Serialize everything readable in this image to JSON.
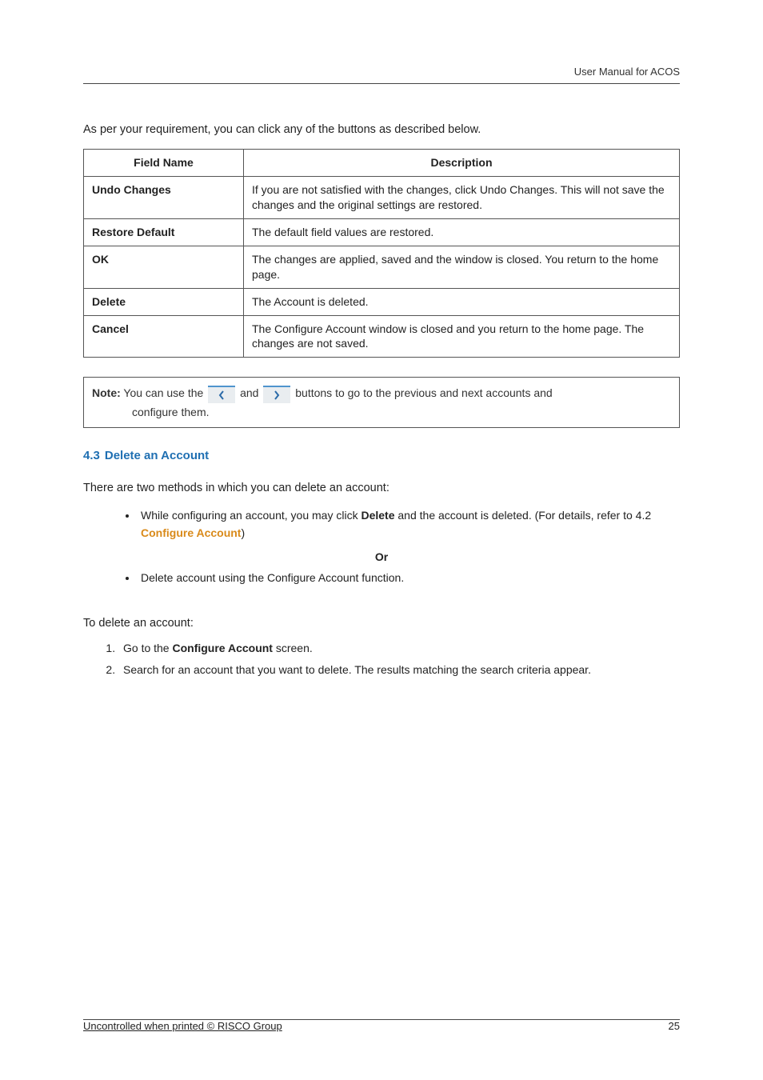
{
  "header": {
    "doc_title": "User Manual for ACOS"
  },
  "intro": "As per your requirement, you can click any of the buttons as described below.",
  "table": {
    "headers": {
      "field": "Field Name",
      "desc": "Description"
    },
    "rows": [
      {
        "field": "Undo Changes",
        "desc": "If you are not satisfied with the changes, click Undo Changes. This will not save the changes and the original settings are restored."
      },
      {
        "field": "Restore Default",
        "desc": "The default field values are restored."
      },
      {
        "field": "OK",
        "desc": "The changes are applied, saved and the window is closed. You return to the home page."
      },
      {
        "field": "Delete",
        "desc": "The Account is deleted."
      },
      {
        "field": "Cancel",
        "desc": "The Configure Account window is closed and you return to the home page. The changes are not saved."
      }
    ]
  },
  "note": {
    "label": "Note:",
    "part1": " You can use the ",
    "and": " and ",
    "part2": " buttons to go to the previous and next accounts and",
    "line2": "configure them."
  },
  "section": {
    "num": "4.3",
    "title": "Delete an Account"
  },
  "p1": "There are two methods in which you can delete an account:",
  "bullet1": {
    "lead": "While configuring an account, you may click ",
    "bold": "Delete",
    "mid": " and the account is deleted. (For details, refer to 4.2 ",
    "link": "Configure Account",
    "tail": ")"
  },
  "or": "Or",
  "bullet2": "Delete account using the Configure Account function.",
  "p2": "To delete an account:",
  "steps": {
    "s1a": "Go to the ",
    "s1b": "Configure Account",
    "s1c": " screen.",
    "s2": "Search for an account that you want to delete. The results matching the search criteria appear."
  },
  "footer": {
    "left": "Uncontrolled when printed © RISCO Group",
    "page": "25"
  }
}
